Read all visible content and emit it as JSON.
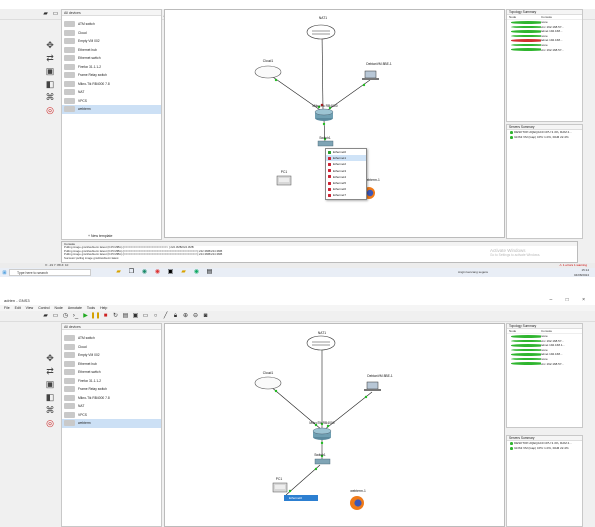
{
  "common": {
    "window_title": "adrien - GNS3",
    "window_controls": "– □ ×",
    "menu": [
      "File",
      "Edit",
      "View",
      "Control",
      "Node",
      "Annotate",
      "Tools",
      "Help"
    ],
    "all_devices_label": "All devices",
    "devices": [
      "ATM switch",
      "Cloud",
      "Empty VM 002",
      "Ethernet hub",
      "Ethernet switch",
      "Firefox 31.1.1-2",
      "Frame Relay switch",
      "Mikro-Tik RB4000 7.8",
      "NAT",
      "VPCS",
      "webterm"
    ],
    "selected_device": "webterm",
    "topology_title": "Topology Summary",
    "topology_cols": [
      "Node",
      "Console"
    ],
    "servers_title": "Servers Summary",
    "servers": [
      "DESKTOP-2QEQAC0 CPU 3.4%, RAM 4...",
      "GNS3 VM (Gap) CPU 1.0%, RAM 22.4%"
    ],
    "icons": {
      "left": [
        "browse-routers-icon",
        "browse-switches-icon",
        "browse-end-devices-icon",
        "browse-security-icon",
        "all-devices-icon",
        "add-link-icon"
      ],
      "accent": "#d03030"
    },
    "nodes": {
      "nat": "NAT1",
      "cloud": "Cloud1",
      "debian": "DebianVM 8BE-1",
      "router": "MikroTik RB4000",
      "switch": "Switch1",
      "pc": "PC1",
      "webterm": "webterm-1"
    }
  },
  "shot1": {
    "topology": [
      {
        "node": "Cloud1",
        "console": "none",
        "status": "green"
      },
      {
        "node": "DebianVM8BE-1",
        "console": "vnc 192.168.57...",
        "status": "green"
      },
      {
        "node": "MikroTikRB4000 7.8",
        "console": "telnet 192.168...",
        "status": "green"
      },
      {
        "node": "NAT1",
        "console": "none",
        "status": "green"
      },
      {
        "node": "PC1",
        "console": "telnet 192.168...",
        "status": "red"
      },
      {
        "node": "Switch1",
        "console": "none",
        "status": "green"
      },
      {
        "node": "webterm-1",
        "console": "vnc 192.168.57...",
        "status": "green"
      }
    ],
    "add_template": "+ New template",
    "context_menu": [
      "Ethernet0",
      "Ethernet1",
      "Ethernet2",
      "Ethernet3",
      "Ethernet4",
      "Ethernet5",
      "Ethernet6",
      "Ethernet7"
    ],
    "context_highlight": "Ethernet1",
    "console_title": "Console",
    "console_lines": [
      "Pulling image gns3/webterm:latest (0.05 MiB/s)  [==========================>                   ]  222.3MB/224.3MB",
      "Pulling image gns3/webterm:latest (0.05 MiB/s)  [============================================>]  222.3MB/224.3MB",
      "Pulling image gns3/webterm:latest (0.05 MiB/s)  [============================================>]  224.3MB/224.3MB",
      "Success! pulling image gns3/webterm:latest"
    ],
    "status_left": "X: -19 Y: 88 Z: 10",
    "status_right": "⚠ 1 errors  1 warning",
    "watermark_title": "Activate Windows",
    "watermark_sub": "Go to Settings to activate Windows.",
    "taskbar_search": "Type here to search",
    "taskbar_notice": "Angin kencang segera",
    "clock_time": "15:14",
    "clock_date": "04/08/2024"
  },
  "shot2": {
    "topology": [
      {
        "node": "Cloud1",
        "console": "none",
        "status": "green"
      },
      {
        "node": "DebianVM8BE-1",
        "console": "vnc 192.168.57...",
        "status": "green"
      },
      {
        "node": "MikroTikRB4000 7.8",
        "console": "telnet 192.168.1...",
        "status": "green"
      },
      {
        "node": "NAT1",
        "console": "none",
        "status": "green"
      },
      {
        "node": "PC1",
        "console": "telnet 192.168...",
        "status": "green"
      },
      {
        "node": "Switch1",
        "console": "none",
        "status": "green"
      },
      {
        "node": "webterm-1",
        "console": "vnc 192.168.57...",
        "status": "green"
      }
    ],
    "popup_label": "Ethernet0"
  }
}
